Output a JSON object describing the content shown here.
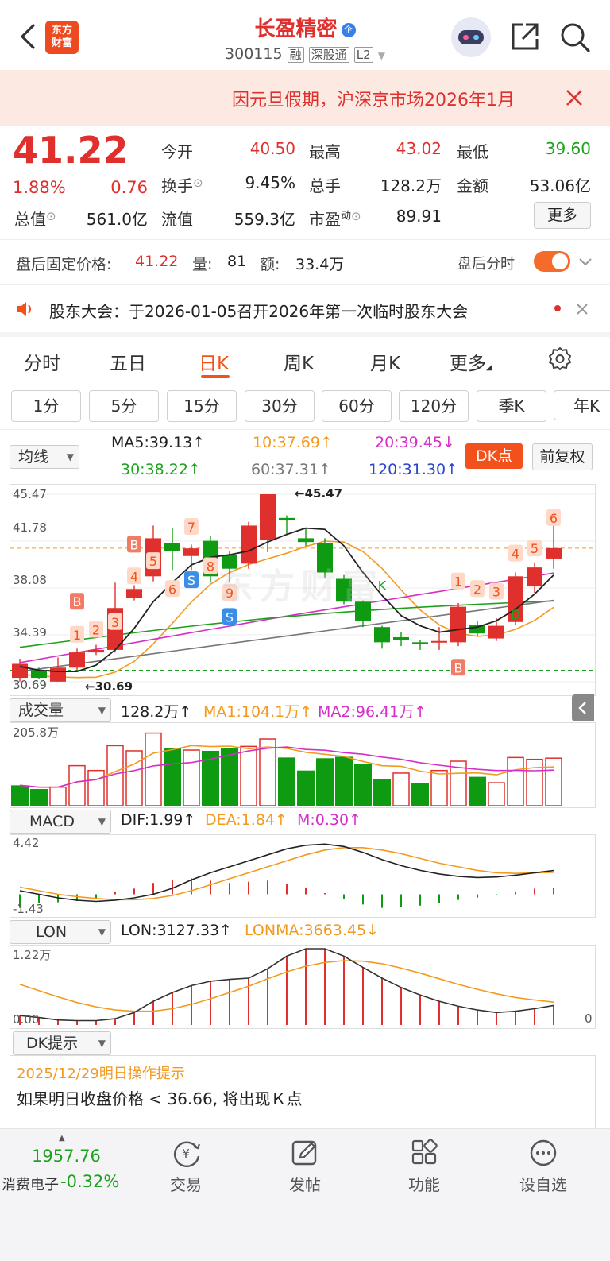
{
  "header": {
    "logo_text": "东方财富",
    "stock_name": "长盈精密",
    "stock_badge": "企",
    "stock_code": "300115",
    "tags": [
      "融",
      "深股通",
      "L2"
    ]
  },
  "banner": {
    "text": "因元旦假期，沪深京市场2026年1月"
  },
  "quote": {
    "price": "41.22",
    "change_pct": "1.88%",
    "change_amt": "0.76",
    "fields": [
      {
        "label": "今开",
        "value": "40.50",
        "color": "red"
      },
      {
        "label": "最高",
        "value": "43.02",
        "color": "red"
      },
      {
        "label": "最低",
        "value": "39.60",
        "color": "green"
      },
      {
        "label": "换手",
        "value": "9.45%",
        "color": "dark"
      },
      {
        "label": "总手",
        "value": "128.2万",
        "color": "dark"
      },
      {
        "label": "金额",
        "value": "53.06亿",
        "color": "dark"
      },
      {
        "label": "总值",
        "value": "561.0亿",
        "color": "dark"
      },
      {
        "label": "流值",
        "value": "559.3亿",
        "color": "dark"
      },
      {
        "label": "市盈",
        "label_sup": "动",
        "value": "89.91",
        "color": "dark"
      }
    ],
    "more_label": "更多"
  },
  "after_hours": {
    "price_label": "盘后固定价格:",
    "price": "41.22",
    "vol_label": "量:",
    "vol": "81",
    "amt_label": "额:",
    "amt": "33.4万",
    "toggle_label": "盘后分时"
  },
  "notice": {
    "text": "股东大会：于2026-01-05召开2026年第一次临时股东大会"
  },
  "tabs": [
    "分时",
    "五日",
    "日K",
    "周K",
    "月K",
    "更多"
  ],
  "active_tab": "日K",
  "periods": [
    "1分",
    "5分",
    "15分",
    "30分",
    "60分",
    "120分",
    "季K",
    "年K"
  ],
  "kline": {
    "selector": "均线",
    "ma_labels": [
      {
        "text": "MA5:39.13↑",
        "color": "#222222"
      },
      {
        "text": "10:37.69↑",
        "color": "#f39a1e"
      },
      {
        "text": "20:39.45↓",
        "color": "#d62ec8"
      },
      {
        "text": "30:38.22↑",
        "color": "#1ea21e"
      },
      {
        "text": "60:37.31↑",
        "color": "#777777"
      },
      {
        "text": "120:31.30↑",
        "color": "#2b45c8"
      }
    ],
    "dk_button": "DK点",
    "adjust_button": "前复权",
    "y_labels": [
      "45.47",
      "41.78",
      "38.08",
      "34.39",
      "30.69"
    ],
    "high_annotation": "←45.47",
    "low_annotation": "←30.69",
    "watermark": "东方财富",
    "marker_texts": [
      "B",
      "B",
      "B",
      "S",
      "S",
      "K",
      "D",
      "1",
      "2",
      "3",
      "4",
      "5",
      "6",
      "7",
      "8",
      "9",
      "1",
      "2",
      "3",
      "4",
      "5",
      "6"
    ]
  },
  "volume": {
    "selector": "成交量",
    "labels": [
      {
        "text": "128.2万↑",
        "color": "#222222"
      },
      {
        "text": "MA1:104.1万↑",
        "color": "#f39a1e"
      },
      {
        "text": "MA2:96.41万↑",
        "color": "#d62ec8"
      }
    ],
    "y_max": "205.8万"
  },
  "macd": {
    "selector": "MACD",
    "labels": [
      {
        "text": "DIF:1.99↑",
        "color": "#222222"
      },
      {
        "text": "DEA:1.84↑",
        "color": "#f39a1e"
      },
      {
        "text": "M:0.30↑",
        "color": "#d62ec8"
      }
    ],
    "y_max": "4.42",
    "y_min": "-1.43"
  },
  "lon": {
    "selector": "LON",
    "labels": [
      {
        "text": "LON:3127.33↑",
        "color": "#222222"
      },
      {
        "text": "LONMA:3663.45↓",
        "color": "#f39a1e"
      }
    ],
    "y_max": "1.22万",
    "y_min": "0.00",
    "right_label": "0"
  },
  "dk_tip": {
    "selector": "DK提示",
    "date_text": "2025/12/29明日操作提示",
    "message": "如果明日收盘价格 < 36.66, 将出现Ｋ点"
  },
  "bottom": {
    "index_value": "1957.76",
    "index_name": "消费电子",
    "index_change": "-0.32%",
    "items": [
      "交易",
      "发帖",
      "功能",
      "设自选"
    ]
  },
  "chart_data": {
    "type": "candlestick",
    "note_axis": "daily bars, oldest to newest",
    "candles": [
      {
        "o": 31.0,
        "c": 32.1,
        "h": 32.5,
        "l": 30.7
      },
      {
        "o": 31.6,
        "c": 31.0,
        "h": 31.8,
        "l": 30.9
      },
      {
        "o": 30.7,
        "c": 31.8,
        "h": 32.6,
        "l": 30.69
      },
      {
        "o": 31.8,
        "c": 33.0,
        "h": 33.3,
        "l": 31.6
      },
      {
        "o": 33.0,
        "c": 33.2,
        "h": 33.6,
        "l": 32.8
      },
      {
        "o": 33.2,
        "c": 36.5,
        "h": 38.5,
        "l": 33.0
      },
      {
        "o": 37.3,
        "c": 38.0,
        "h": 38.3,
        "l": 37.1
      },
      {
        "o": 39.0,
        "c": 42.0,
        "h": 43.0,
        "l": 38.6
      },
      {
        "o": 41.6,
        "c": 41.0,
        "h": 42.8,
        "l": 39.5
      },
      {
        "o": 40.6,
        "c": 41.2,
        "h": 41.5,
        "l": 39.5
      },
      {
        "o": 41.8,
        "c": 39.0,
        "h": 42.2,
        "l": 38.5
      },
      {
        "o": 40.7,
        "c": 39.6,
        "h": 41.0,
        "l": 38.5
      },
      {
        "o": 40.0,
        "c": 43.0,
        "h": 43.3,
        "l": 39.6
      },
      {
        "o": 41.9,
        "c": 45.47,
        "h": 45.47,
        "l": 40.9
      },
      {
        "o": 43.6,
        "c": 43.4,
        "h": 43.8,
        "l": 42.3
      },
      {
        "o": 42.0,
        "c": 41.7,
        "h": 42.8,
        "l": 41.4
      },
      {
        "o": 41.6,
        "c": 39.3,
        "h": 42.0,
        "l": 38.9
      },
      {
        "o": 38.8,
        "c": 37.0,
        "h": 39.1,
        "l": 36.8
      },
      {
        "o": 37.0,
        "c": 35.5,
        "h": 37.1,
        "l": 35.0
      },
      {
        "o": 35.0,
        "c": 33.8,
        "h": 35.1,
        "l": 33.3
      },
      {
        "o": 34.2,
        "c": 34.0,
        "h": 34.6,
        "l": 33.5
      },
      {
        "o": 33.8,
        "c": 33.7,
        "h": 34.0,
        "l": 33.2
      },
      {
        "o": 33.8,
        "c": 33.9,
        "h": 35.0,
        "l": 33.2
      },
      {
        "o": 33.8,
        "c": 36.6,
        "h": 36.9,
        "l": 33.5
      },
      {
        "o": 35.2,
        "c": 34.5,
        "h": 35.5,
        "l": 34.3
      },
      {
        "o": 34.1,
        "c": 35.1,
        "h": 35.7,
        "l": 33.9
      },
      {
        "o": 35.4,
        "c": 39.0,
        "h": 39.3,
        "l": 35.2
      },
      {
        "o": 38.2,
        "c": 39.7,
        "h": 40.1,
        "l": 37.7
      },
      {
        "o": 40.4,
        "c": 41.22,
        "h": 43.02,
        "l": 39.6
      }
    ],
    "ma5": [
      31.9,
      31.6,
      31.5,
      31.5,
      32.0,
      33.2,
      34.9,
      37.0,
      38.5,
      39.9,
      40.5,
      40.7,
      41.0,
      41.7,
      42.3,
      42.8,
      42.7,
      41.4,
      39.3,
      37.5,
      35.9,
      35.1,
      34.6,
      34.8,
      35.0,
      35.5,
      36.4,
      37.6,
      39.1
    ],
    "volume": [
      {
        "v": 55,
        "up": false
      },
      {
        "v": 45,
        "up": false
      },
      {
        "v": 50,
        "up": true
      },
      {
        "v": 108,
        "up": true
      },
      {
        "v": 95,
        "up": true
      },
      {
        "v": 162,
        "up": true
      },
      {
        "v": 148,
        "up": true
      },
      {
        "v": 196,
        "up": true
      },
      {
        "v": 155,
        "up": false
      },
      {
        "v": 150,
        "up": true
      },
      {
        "v": 148,
        "up": false
      },
      {
        "v": 155,
        "up": false
      },
      {
        "v": 160,
        "up": true
      },
      {
        "v": 180,
        "up": true
      },
      {
        "v": 130,
        "up": false
      },
      {
        "v": 95,
        "up": false
      },
      {
        "v": 128,
        "up": false
      },
      {
        "v": 132,
        "up": false
      },
      {
        "v": 112,
        "up": false
      },
      {
        "v": 72,
        "up": false
      },
      {
        "v": 88,
        "up": true
      },
      {
        "v": 62,
        "up": false
      },
      {
        "v": 95,
        "up": true
      },
      {
        "v": 120,
        "up": true
      },
      {
        "v": 78,
        "up": false
      },
      {
        "v": 62,
        "up": true
      },
      {
        "v": 130,
        "up": true
      },
      {
        "v": 125,
        "up": true
      },
      {
        "v": 128.2,
        "up": true
      }
    ],
    "macd_m": [
      -0.6,
      -0.4,
      -0.35,
      -0.3,
      -0.2,
      0.1,
      0.25,
      0.5,
      0.65,
      0.7,
      0.6,
      0.5,
      0.55,
      0.6,
      0.45,
      0.3,
      0.05,
      -0.2,
      -0.45,
      -0.6,
      -0.55,
      -0.5,
      -0.4,
      -0.25,
      -0.15,
      -0.05,
      0.1,
      0.25,
      0.3
    ],
    "macd_dif": [
      0.3,
      0.0,
      -0.3,
      -0.5,
      -0.6,
      -0.5,
      -0.3,
      0.0,
      0.5,
      1.2,
      1.8,
      2.3,
      2.8,
      3.3,
      3.8,
      4.1,
      4.2,
      4.0,
      3.5,
      2.9,
      2.4,
      2.0,
      1.7,
      1.5,
      1.4,
      1.45,
      1.6,
      1.8,
      1.99
    ],
    "macd_dea": [
      0.6,
      0.3,
      0.0,
      -0.2,
      -0.35,
      -0.45,
      -0.45,
      -0.35,
      -0.1,
      0.3,
      0.8,
      1.3,
      1.8,
      2.3,
      2.8,
      3.3,
      3.7,
      3.9,
      3.9,
      3.7,
      3.4,
      3.0,
      2.6,
      2.3,
      2.0,
      1.8,
      1.75,
      1.8,
      1.84
    ],
    "lon_bars": [
      1500,
      1200,
      800,
      700,
      700,
      1000,
      2000,
      3800,
      5200,
      6300,
      7000,
      7300,
      7500,
      9000,
      11000,
      12200,
      12200,
      11000,
      9200,
      7500,
      6000,
      4800,
      3800,
      3000,
      2400,
      2000,
      2200,
      2600,
      3127.33
    ],
    "lon_line": [
      1500,
      1200,
      800,
      700,
      700,
      1000,
      2000,
      3800,
      5200,
      6300,
      7000,
      7300,
      7500,
      9000,
      11000,
      12200,
      12200,
      11000,
      9200,
      7500,
      6000,
      4800,
      3800,
      3000,
      2400,
      2000,
      2200,
      2600,
      3127.33
    ],
    "lon_ma": [
      6500,
      5500,
      4500,
      3600,
      2900,
      2400,
      2200,
      2200,
      2600,
      3300,
      4200,
      5200,
      6200,
      7400,
      8500,
      9400,
      10000,
      10300,
      10200,
      9800,
      9100,
      8300,
      7400,
      6500,
      5700,
      5000,
      4400,
      4000,
      3663.45
    ]
  }
}
